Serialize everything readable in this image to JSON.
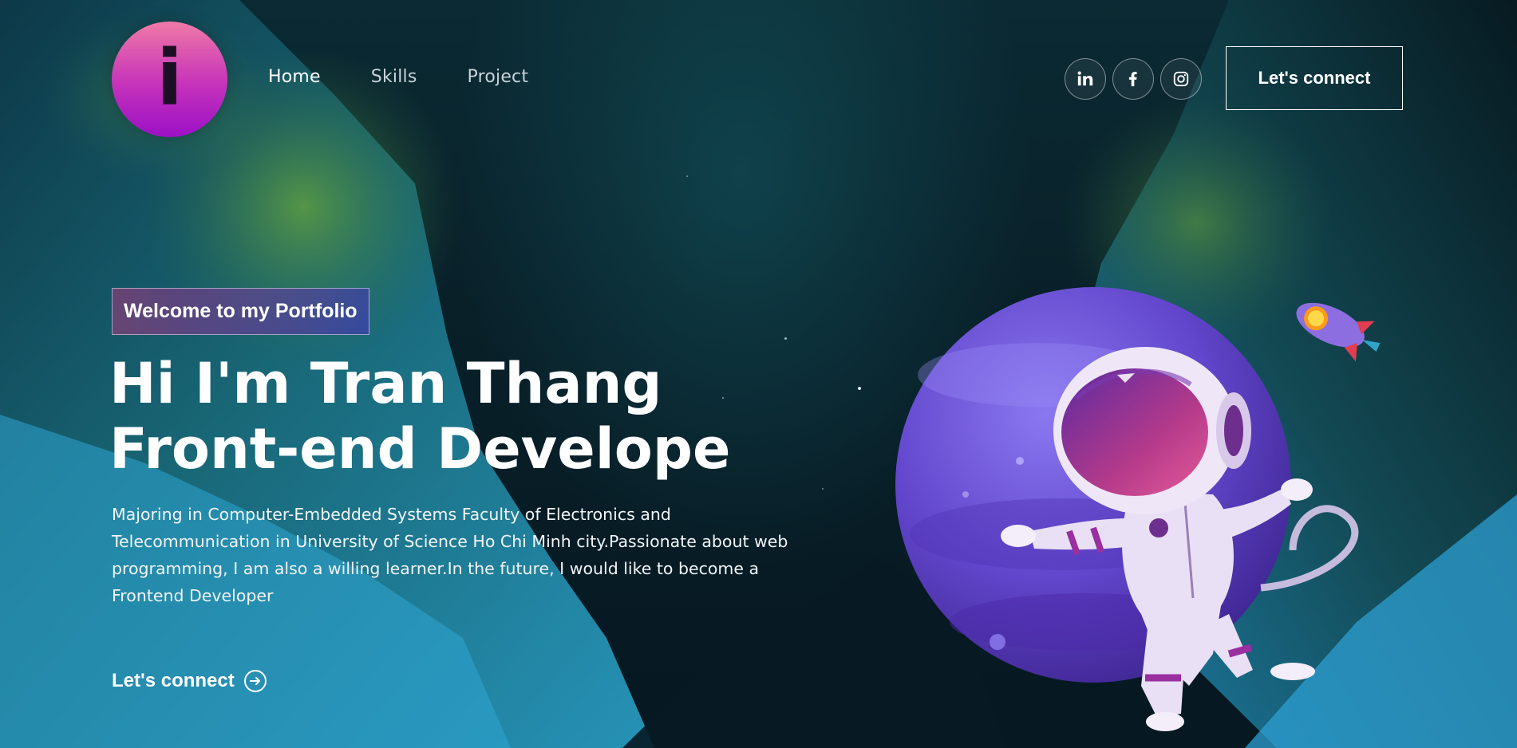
{
  "header": {
    "logo_letter": "i",
    "nav": [
      {
        "label": "Home",
        "active": true
      },
      {
        "label": "Skills",
        "active": false
      },
      {
        "label": "Project",
        "active": false
      }
    ],
    "socials": [
      "linkedin-icon",
      "facebook-icon",
      "instagram-icon"
    ],
    "connect_label": "Let's connect"
  },
  "hero": {
    "tagline": "Welcome to my Portfolio",
    "headline_line1": "Hi I'm Tran Thang",
    "headline_line2": "Front-end Develope",
    "description": "Majoring in Computer-Embedded Systems Faculty of Electronics and Telecommunication in University of Science Ho Chi Minh city.Passionate about web programming, I am also a willing learner.In the future, I would like to become a Frontend Developer",
    "cta_label": "Let's connect"
  },
  "colors": {
    "logo_top": "#f079a6",
    "logo_bottom": "#9c10c6",
    "planet": "#6a4fd4",
    "background": "#092029"
  }
}
